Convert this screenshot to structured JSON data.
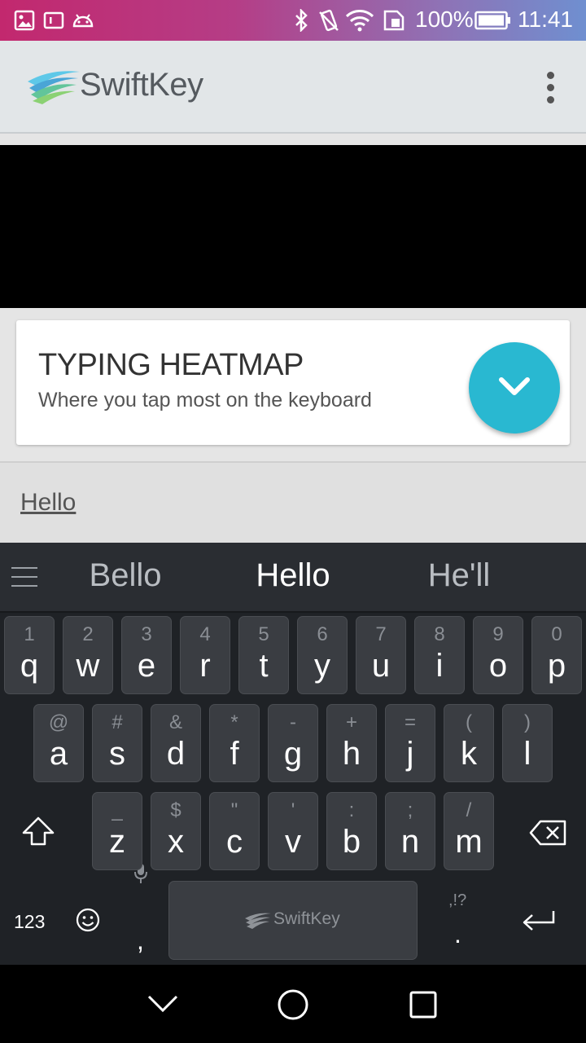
{
  "status_bar": {
    "battery_percent": "100%",
    "time": "11:41",
    "icons": [
      "gallery-icon",
      "notification-icon",
      "android-icon",
      "bluetooth-icon",
      "vibrate-icon",
      "wifi-icon",
      "sim-icon",
      "battery-icon"
    ]
  },
  "app_bar": {
    "brand": "SwiftKey",
    "menu_icon": "more-vert-icon"
  },
  "card": {
    "title": "TYPING HEATMAP",
    "subtitle": "Where you tap most on the keyboard",
    "button_icon": "chevron-down-icon",
    "accent_color": "#29b8d1"
  },
  "text_field": {
    "value": "Hello"
  },
  "keyboard": {
    "suggestions": [
      "Bello",
      "Hello",
      "He'll"
    ],
    "rows": [
      [
        {
          "pri": "q",
          "sec": "1"
        },
        {
          "pri": "w",
          "sec": "2"
        },
        {
          "pri": "e",
          "sec": "3"
        },
        {
          "pri": "r",
          "sec": "4"
        },
        {
          "pri": "t",
          "sec": "5"
        },
        {
          "pri": "y",
          "sec": "6"
        },
        {
          "pri": "u",
          "sec": "7"
        },
        {
          "pri": "i",
          "sec": "8"
        },
        {
          "pri": "o",
          "sec": "9"
        },
        {
          "pri": "p",
          "sec": "0"
        }
      ],
      [
        {
          "pri": "a",
          "sec": "@"
        },
        {
          "pri": "s",
          "sec": "#"
        },
        {
          "pri": "d",
          "sec": "&"
        },
        {
          "pri": "f",
          "sec": "*"
        },
        {
          "pri": "g",
          "sec": "-"
        },
        {
          "pri": "h",
          "sec": "+"
        },
        {
          "pri": "j",
          "sec": "="
        },
        {
          "pri": "k",
          "sec": "("
        },
        {
          "pri": "l",
          "sec": ")"
        }
      ],
      [
        {
          "pri": "z",
          "sec": "_"
        },
        {
          "pri": "x",
          "sec": "$"
        },
        {
          "pri": "c",
          "sec": "\""
        },
        {
          "pri": "v",
          "sec": "'"
        },
        {
          "pri": "b",
          "sec": ":"
        },
        {
          "pri": "n",
          "sec": ";"
        },
        {
          "pri": "m",
          "sec": "/"
        }
      ]
    ],
    "numbers_key": "123",
    "comma_key": ",",
    "period_key": ".",
    "punct_hint": ",!?",
    "space_label": "SwiftKey"
  },
  "nav_bar": {
    "icons": [
      "back-icon",
      "home-icon",
      "recents-icon"
    ]
  }
}
